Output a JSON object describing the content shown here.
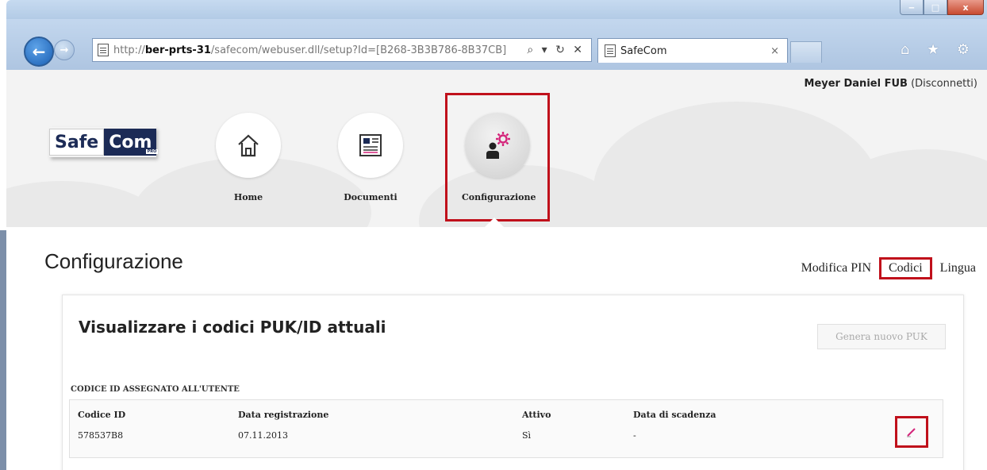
{
  "browser": {
    "url_prefix": "http://",
    "url_host": "ber-prts-31",
    "url_path": "/safecom/webuser.dll/setup?Id=[B268-3B3B786-8B37CB]",
    "address_controls": "⌕ ▾ ↻ ✕",
    "tab_title": "SafeCom",
    "tab_close": "×",
    "right_icons": "⌂ ★ ⚙",
    "win_min": "‒",
    "win_max": "□",
    "win_close": "x"
  },
  "header": {
    "user_name": "Meyer Daniel FUB",
    "logout_label": "(Disconnetti)",
    "logo_part1": "Safe",
    "logo_part2": "Com",
    "logo_tag": "PRO"
  },
  "nav": {
    "items": [
      {
        "label": "Home",
        "icon": "home-icon"
      },
      {
        "label": "Documenti",
        "icon": "document-icon"
      },
      {
        "label": "Configurazione",
        "icon": "settings-user-icon"
      }
    ],
    "active": "Configurazione"
  },
  "page": {
    "title": "Configurazione",
    "subnav": [
      "Modifica PIN",
      "Codici",
      "Lingua"
    ],
    "subnav_active": "Codici"
  },
  "card": {
    "title": "Visualizzare i codici PUK/ID attuali",
    "generate_button": "Genera nuovo PUK",
    "section_label": "CODICE ID ASSEGNATO ALL'UTENTE",
    "columns": [
      "Codice ID",
      "Data registrazione",
      "Attivo",
      "Data di scadenza"
    ],
    "rows": [
      {
        "codice_id": "578537B8",
        "data_registrazione": "07.11.2013",
        "attivo": "Sì",
        "data_scadenza": "-"
      }
    ]
  },
  "colors": {
    "highlight": "#c0101b",
    "brand_dark": "#1c2b56",
    "accent_pink": "#d4247a"
  }
}
